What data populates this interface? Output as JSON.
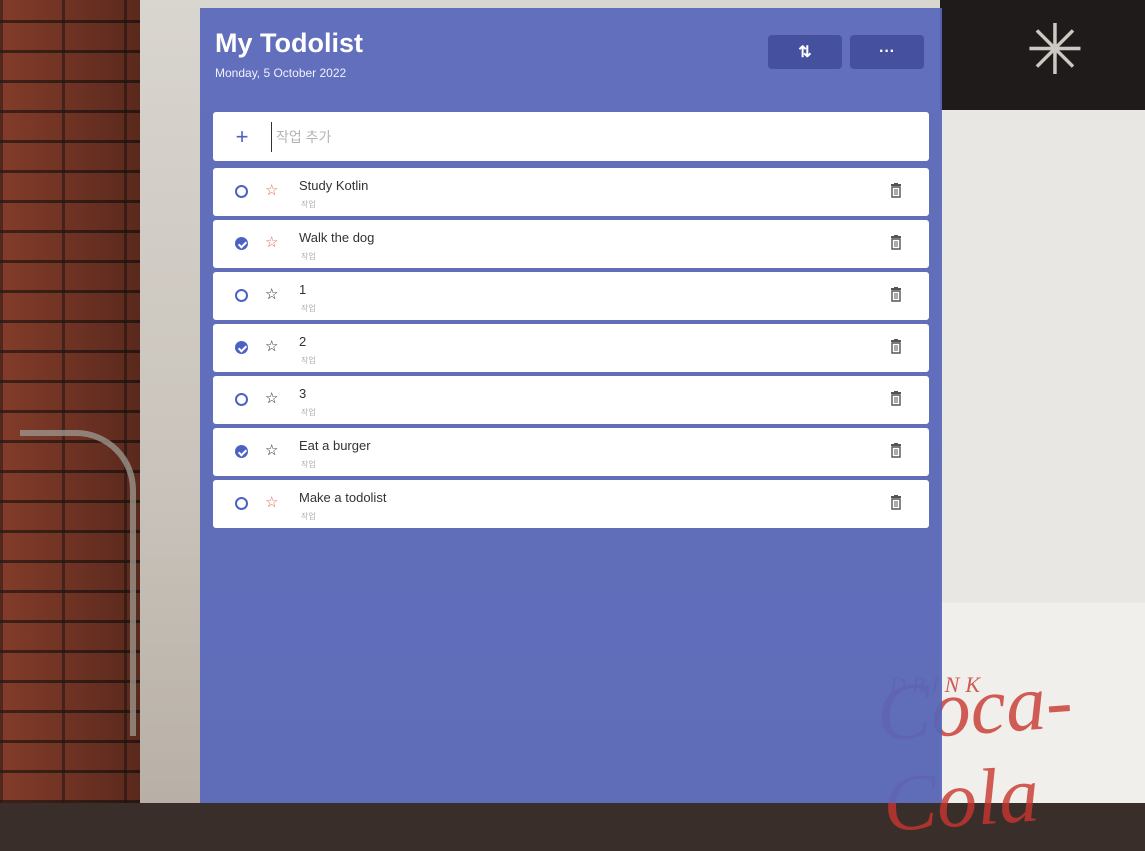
{
  "app": {
    "title": "My Todolist",
    "date": "Monday, 5 October 2022",
    "sort_label": "⇅",
    "more_label": "···"
  },
  "add_task": {
    "icon": "plus-icon",
    "placeholder": "작업 추가"
  },
  "tasks": [
    {
      "title": "Study Kotlin",
      "subtitle": "작업",
      "completed": false,
      "important": true
    },
    {
      "title": "Walk the dog",
      "subtitle": "작업",
      "completed": true,
      "important": true
    },
    {
      "title": "1",
      "subtitle": "작업",
      "completed": false,
      "important": false
    },
    {
      "title": "2",
      "subtitle": "작업",
      "completed": true,
      "important": false
    },
    {
      "title": "3",
      "subtitle": "작업",
      "completed": false,
      "important": false
    },
    {
      "title": "Eat a burger",
      "subtitle": "작업",
      "completed": true,
      "important": false
    },
    {
      "title": "Make a todolist",
      "subtitle": "작업",
      "completed": false,
      "important": true
    }
  ],
  "background": {
    "drink_text": "DRINK",
    "brand_text": "Coca-Cola"
  },
  "colors": {
    "panel": "#5867ba",
    "accent": "#4b62c4",
    "important_star": "#e0694a"
  }
}
